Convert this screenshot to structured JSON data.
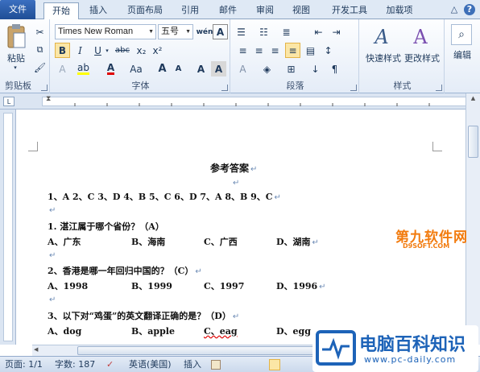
{
  "tabs": [
    "文件",
    "开始",
    "插入",
    "页面布局",
    "引用",
    "邮件",
    "审阅",
    "视图",
    "开发工具",
    "加载项"
  ],
  "window": {
    "help": "?",
    "minimize": "△"
  },
  "clipboard": {
    "paste": "粘贴",
    "group": "剪贴板"
  },
  "font": {
    "name": "Times New Roman",
    "size": "五号",
    "group": "字体",
    "wen": "wén",
    "bold": "B",
    "italic": "I",
    "underline": "U",
    "strike": "abc",
    "sub": "x₂",
    "sup": "x²",
    "grow": "A",
    "shrink": "A",
    "aa": "Aa",
    "clear": "A",
    "phonetic": "A",
    "border": "A"
  },
  "paragraph": {
    "group": "段落"
  },
  "styles": {
    "quick": "快速样式",
    "change": "更改样式",
    "group": "样式"
  },
  "editing": {
    "label": "编辑"
  },
  "document": {
    "title": "参考答案",
    "answers": "1、A   2、C   3、D   4、B   5、C   6、D   7、A   8、B   9、C",
    "q1": "1.   湛江属于哪个省份？（A）",
    "q1opts": [
      "A、广东",
      "B、海南",
      "C、广西",
      "D、湖南"
    ],
    "q2": "2、香港是哪一年回归中国的？（C）",
    "q2opts": [
      "A、1998",
      "B、1999",
      "C、1997",
      "D、1996"
    ],
    "q3": "3、以下对“鸡蛋”的英文翻译正确的是？（D）",
    "q3opts": [
      "A、dog",
      "B、apple",
      "C、eag",
      "D、egg"
    ]
  },
  "status": {
    "page": "页面: 1/1",
    "words": "字数: 187",
    "lang": "英语(美国)",
    "mode": "插入"
  },
  "watermark": {
    "top": "第九软件网",
    "top_sub": "D9SOFT.COM",
    "brand": "电脑百科知识",
    "url": "www.pc-daily.com"
  },
  "colors": {
    "accent": "#2b579a",
    "highlight": "#fbe6a6"
  }
}
